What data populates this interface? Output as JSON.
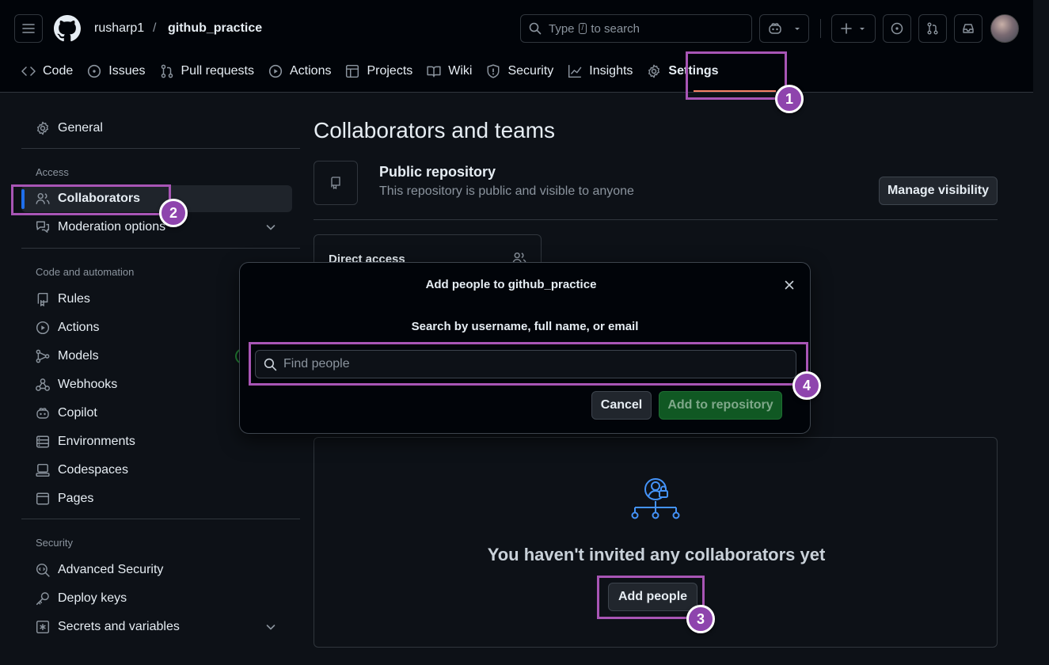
{
  "header": {
    "owner": "rusharp1",
    "separator": "/",
    "repo": "github_practice",
    "search_prefix": "Type",
    "search_key": "/",
    "search_suffix": "to search"
  },
  "tabs": [
    {
      "label": "Code",
      "icon": "code-icon"
    },
    {
      "label": "Issues",
      "icon": "issue-icon"
    },
    {
      "label": "Pull requests",
      "icon": "pull-request-icon"
    },
    {
      "label": "Actions",
      "icon": "play-icon"
    },
    {
      "label": "Projects",
      "icon": "table-icon"
    },
    {
      "label": "Wiki",
      "icon": "book-icon"
    },
    {
      "label": "Security",
      "icon": "shield-icon"
    },
    {
      "label": "Insights",
      "icon": "graph-icon"
    },
    {
      "label": "Settings",
      "icon": "gear-icon",
      "active": true
    }
  ],
  "sidebar": {
    "general": "General",
    "access_heading": "Access",
    "collaborators": "Collaborators",
    "moderation": "Moderation options",
    "code_heading": "Code and automation",
    "rules": "Rules",
    "actions": "Actions",
    "models": "Models",
    "webhooks": "Webhooks",
    "copilot": "Copilot",
    "environments": "Environments",
    "codespaces": "Codespaces",
    "pages": "Pages",
    "security_heading": "Security",
    "advanced_security": "Advanced Security",
    "deploy_keys": "Deploy keys",
    "secrets": "Secrets and variables"
  },
  "main": {
    "title": "Collaborators and teams",
    "public_title": "Public repository",
    "public_desc": "This repository is public and visible to anyone",
    "manage_visibility": "Manage visibility",
    "direct_access": "Direct access",
    "empty_text": "You haven't invited any collaborators yet",
    "add_people": "Add people"
  },
  "modal": {
    "title": "Add people to github_practice",
    "label": "Search by username, full name, or email",
    "placeholder": "Find people",
    "cancel": "Cancel",
    "add": "Add to repository"
  },
  "annotations": {
    "step1": "1",
    "step2": "2",
    "step3": "3",
    "step4": "4",
    "highlight_color": "#a855b5",
    "badge_color": "#8e44ad"
  },
  "colors": {
    "background": "#0d1117",
    "header": "#010409",
    "accent_tab": "#f78166",
    "active_bar": "#1f6feb",
    "primary_button": "#105823"
  }
}
